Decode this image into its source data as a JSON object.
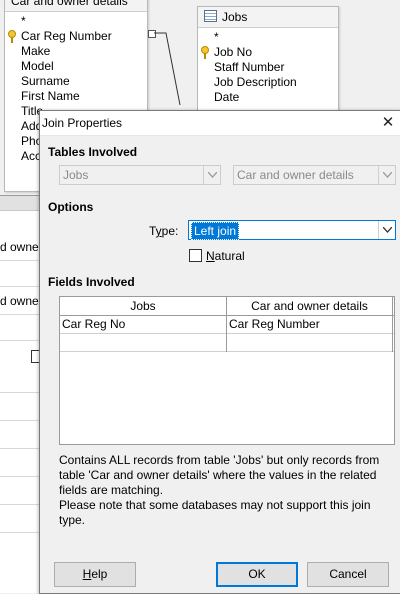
{
  "design": {
    "tables": [
      {
        "title": "Car and owner details",
        "fields": [
          "*",
          "Car Reg Number",
          "Make",
          "Model",
          "Surname",
          "First Name",
          "Title",
          "Address",
          "Phone",
          "Account"
        ],
        "key_field_index": 1
      },
      {
        "title": "Jobs",
        "fields": [
          "*",
          "Job No",
          "Staff Number",
          "Job Description",
          "Date"
        ],
        "key_field_index": 1
      }
    ],
    "grid_rows": [
      "d owner",
      "",
      "d owner",
      "",
      "",
      "",
      "",
      "",
      "",
      ""
    ]
  },
  "dialog": {
    "title": "Join Properties",
    "close_icon": "close-icon",
    "tables_involved": {
      "heading": "Tables Involved",
      "left_table": "Jobs",
      "right_table": "Car and owner details"
    },
    "options": {
      "heading": "Options",
      "type_label_prefix": "T",
      "type_label_underlined": "y",
      "type_label_suffix": "pe:",
      "type_value": "Left join",
      "natural_label_prefix": "",
      "natural_label_underlined": "N",
      "natural_label_suffix": "atural",
      "natural_checked": false
    },
    "fields_involved": {
      "heading": "Fields Involved",
      "columns": [
        "Jobs",
        "Car and owner details"
      ],
      "rows": [
        [
          "Car Reg No",
          "Car Reg Number"
        ],
        [
          "",
          ""
        ]
      ]
    },
    "description": [
      "Contains ALL records from table 'Jobs' but only records from table 'Car and owner details' where the values in the related fields are matching.",
      "Please note that some databases may not support this join type."
    ],
    "buttons": {
      "help_underlined": "H",
      "help_rest": "elp",
      "ok": "OK",
      "cancel": "Cancel"
    },
    "colors": {
      "selection": "#0078d7",
      "default_button_border": "#0078d7"
    }
  }
}
